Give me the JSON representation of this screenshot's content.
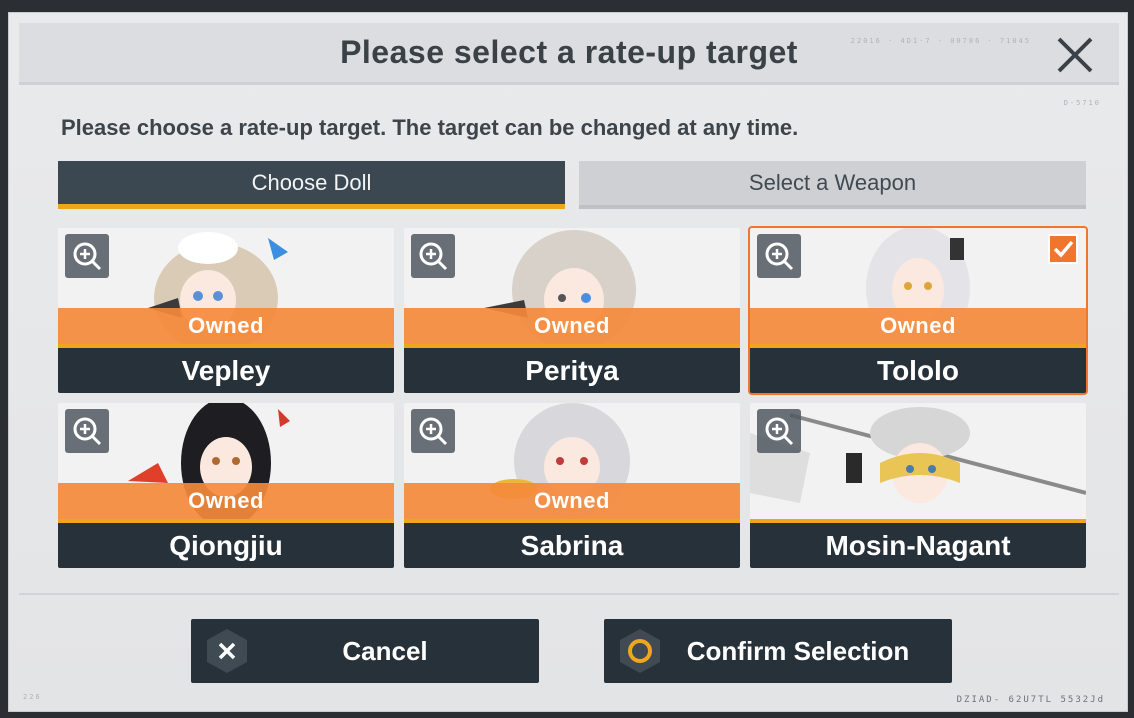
{
  "dialog": {
    "title": "Please select a rate-up target",
    "subtitle": "Please choose a rate-up target. The target can be changed at any time.",
    "deco_top": "22016 · 4D1·7 · 00786 · 71045",
    "deco_code": "D-5710",
    "deco_bottom_left": "226",
    "deco_bottom_right": "DZIAD- 62U7TL 5532Jd"
  },
  "tabs": [
    {
      "label": "Choose Doll",
      "active": true
    },
    {
      "label": "Select a Weapon",
      "active": false
    }
  ],
  "cards": [
    {
      "name": "Vepley",
      "status": "Owned",
      "selected": false
    },
    {
      "name": "Peritya",
      "status": "Owned",
      "selected": false
    },
    {
      "name": "Tololo",
      "status": "Owned",
      "selected": true
    },
    {
      "name": "Qiongjiu",
      "status": "Owned",
      "selected": false
    },
    {
      "name": "Sabrina",
      "status": "Owned",
      "selected": false
    },
    {
      "name": "Mosin-Nagant",
      "status": "",
      "selected": false
    }
  ],
  "buttons": {
    "cancel_label": "Cancel",
    "confirm_label": "Confirm Selection"
  },
  "colors": {
    "accent_orange": "#f0762e",
    "owned_band": "#f58a3c",
    "underline_gold": "#f0a51e",
    "dark_panel": "#26313a"
  },
  "icons": [
    "close-icon",
    "zoom-in-icon",
    "checkmark-icon",
    "cancel-x-icon",
    "confirm-circle-icon"
  ]
}
